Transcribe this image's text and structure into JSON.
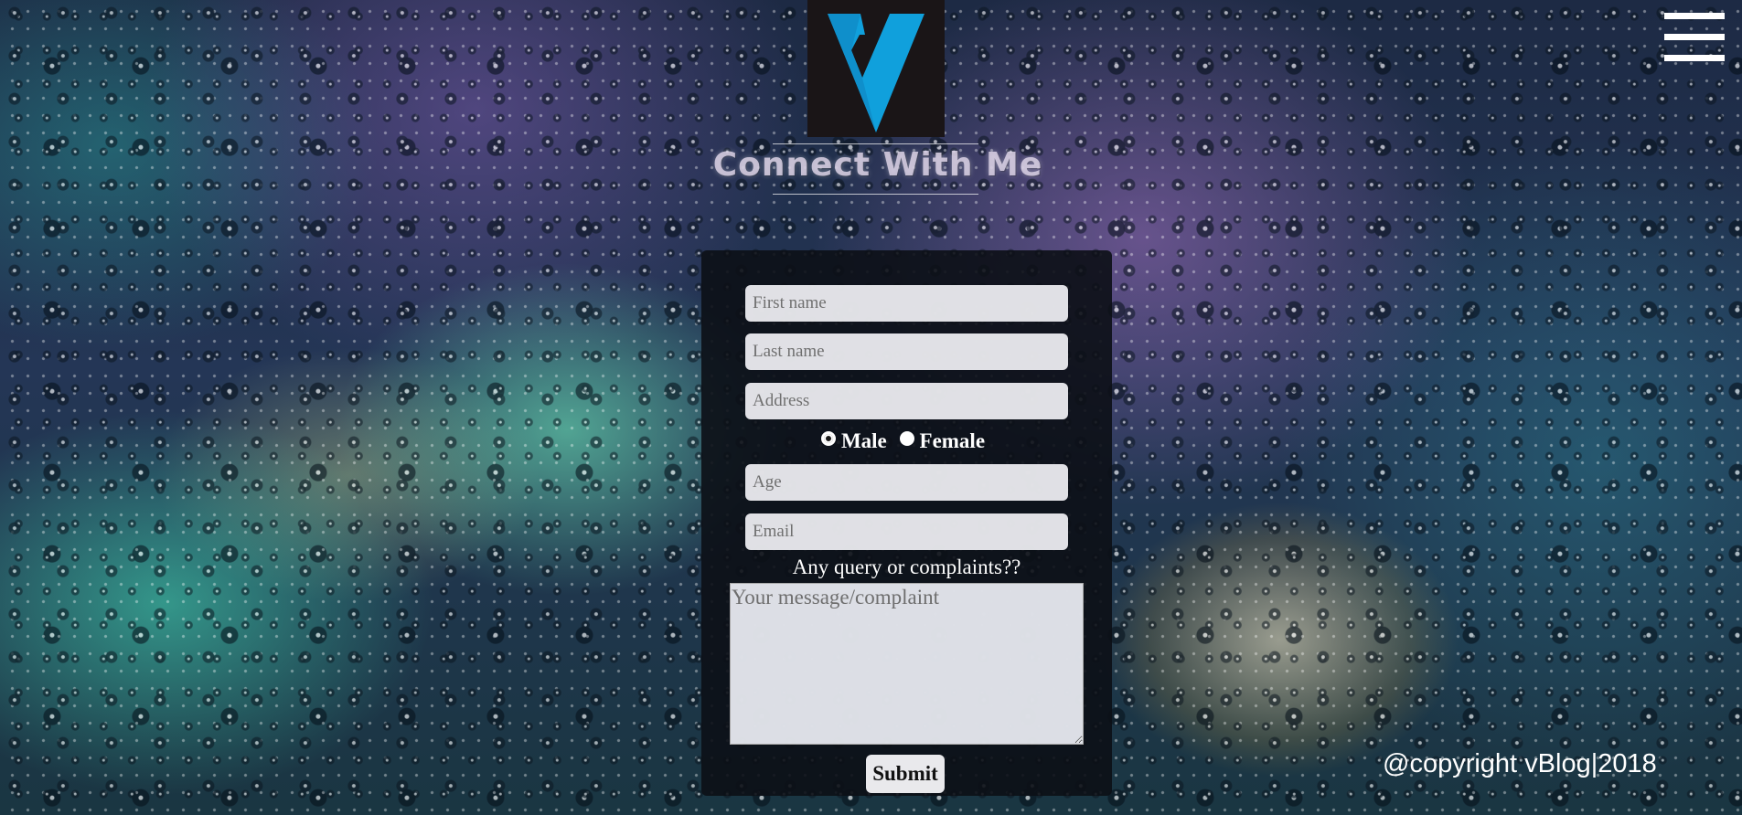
{
  "header": {
    "logo_icon": "v-logo-icon",
    "menu_icon": "hamburger-menu-icon",
    "title": "Connect With Me"
  },
  "form": {
    "first_name": {
      "placeholder": "First name"
    },
    "last_name": {
      "placeholder": "Last name"
    },
    "address": {
      "placeholder": "Address"
    },
    "gender": {
      "options": [
        "Male",
        "Female"
      ],
      "selected": "Male"
    },
    "age": {
      "placeholder": "Age"
    },
    "email": {
      "placeholder": "Email"
    },
    "query_label": "Any query or complaints??",
    "message": {
      "placeholder": "Your message/complaint"
    },
    "submit_label": "Submit"
  },
  "footer": {
    "copyright": "@copyright vBlog|2018"
  },
  "colors": {
    "logo_bg": "#1a1517",
    "logo_accent": "#10a0dc",
    "card_bg": "#0c1016",
    "field_bg": "#f0f0f4"
  }
}
